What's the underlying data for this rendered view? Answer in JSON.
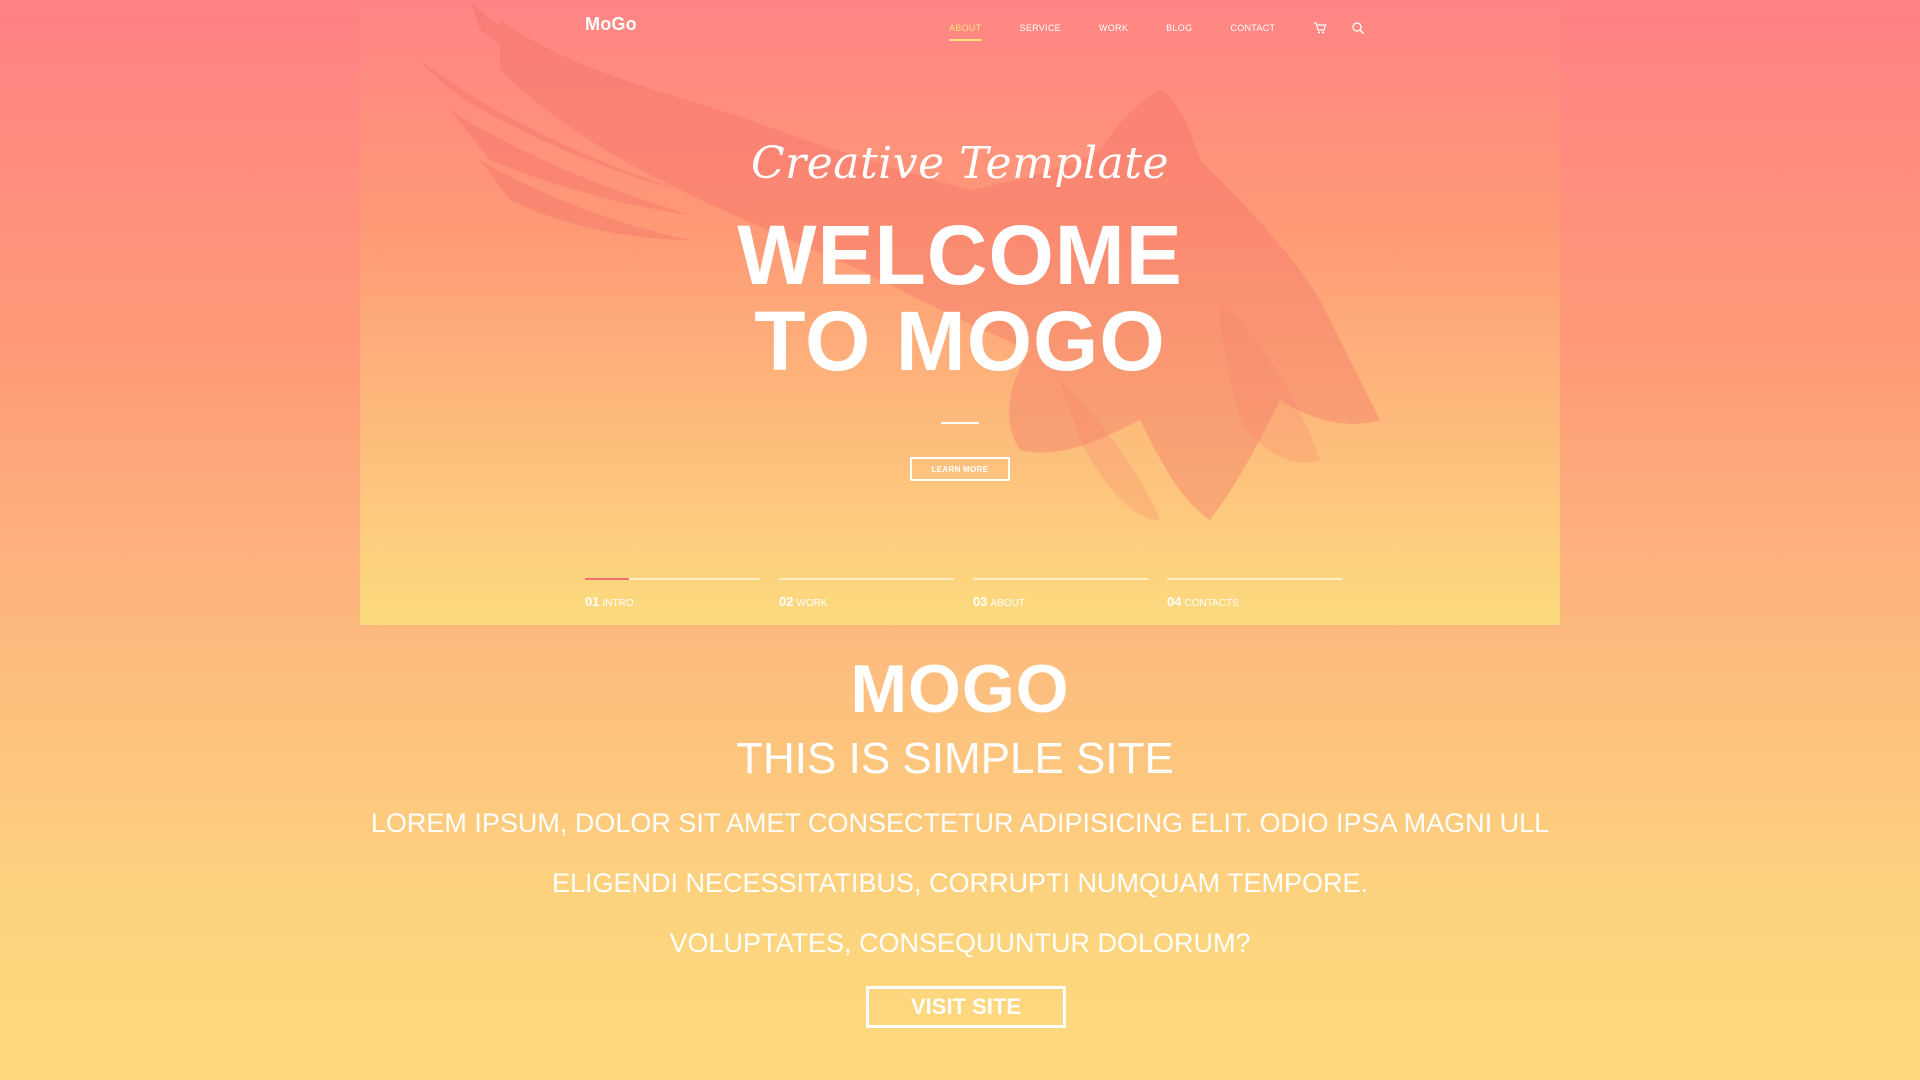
{
  "header": {
    "logo": "MoGo",
    "nav": [
      "ABOUT",
      "SERVICE",
      "WORK",
      "BLOG",
      "CONTACT"
    ],
    "active_nav": "ABOUT",
    "icons": [
      "cart-icon",
      "search-icon"
    ]
  },
  "hero": {
    "script_title": "Creative Template",
    "title_line1": "WELCOME",
    "title_line2": "TO MOGO",
    "learn_more": "LEARN MORE",
    "slides": [
      {
        "num": "01",
        "label": "INTRO",
        "progress": 0.25
      },
      {
        "num": "02",
        "label": "WORK",
        "progress": 0
      },
      {
        "num": "03",
        "label": "ABOUT",
        "progress": 0
      },
      {
        "num": "04",
        "label": "CONTACTS",
        "progress": 0
      }
    ]
  },
  "section": {
    "title": "MOGO",
    "subtitle": "THIS IS SIMPLE SITE",
    "lines": [
      "LOREM IPSUM, DOLOR SIT AMET CONSECTETUR ADIPISICING ELIT. ODIO IPSA MAGNI ULL",
      "ELIGENDI NECESSITATIBUS, CORRUPTI NUMQUAM TEMPORE.",
      "VOLUPTATES, CONSEQUUNTUR DOLORUM?"
    ],
    "button": "VISIT SITE"
  },
  "colors": {
    "accent": "#fde17f",
    "slide_active": "#f36f6f",
    "top": "#ff8184",
    "bottom": "#fed97e"
  }
}
